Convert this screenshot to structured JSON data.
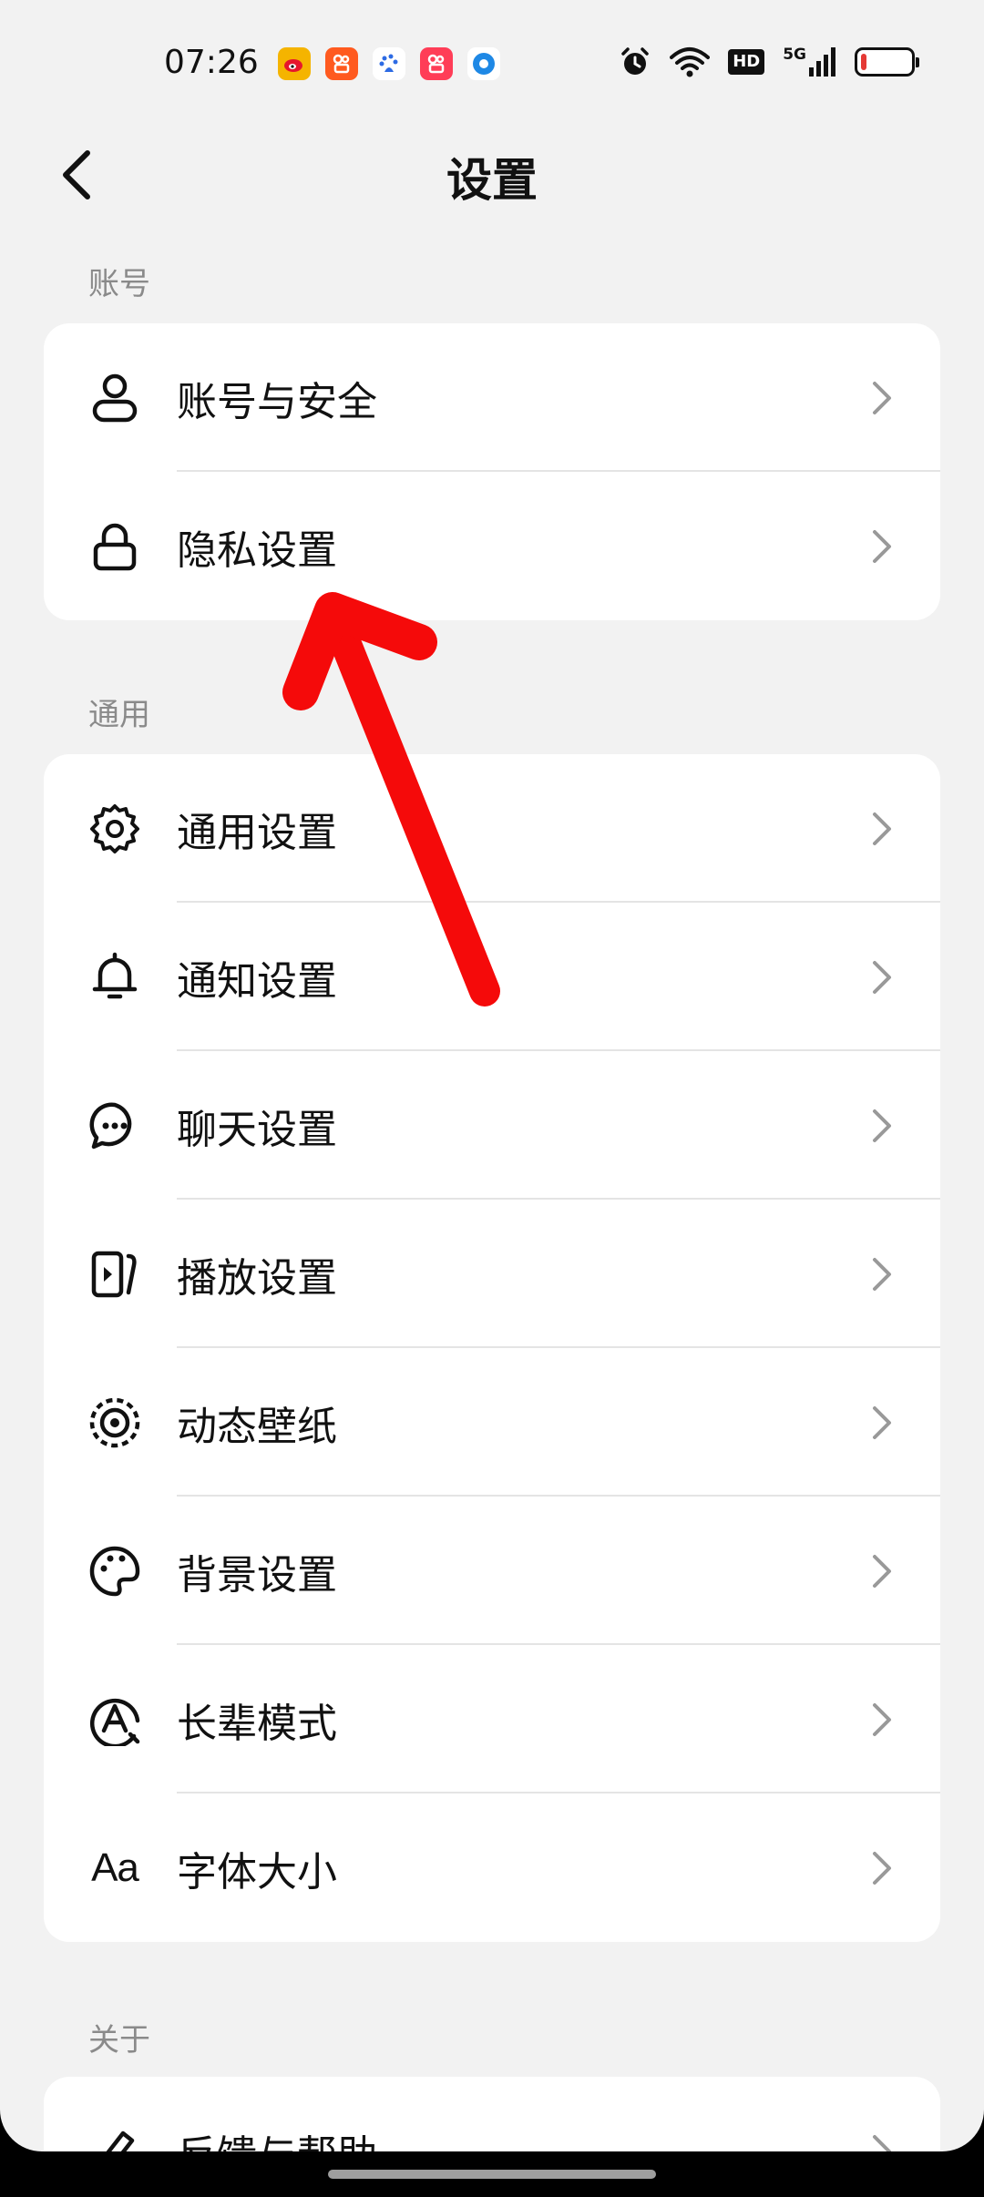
{
  "status_bar": {
    "time": "07:26",
    "notifications": [
      {
        "icon": "weibo-icon",
        "color": "#f5b400"
      },
      {
        "icon": "kuaishou-icon",
        "color": "#ff5a1f"
      },
      {
        "icon": "baidu-icon",
        "color": "#ffffff"
      },
      {
        "icon": "kuaishou-lite-icon",
        "color": "#ff3d57"
      },
      {
        "icon": "app-circle-icon",
        "color": "#ffffff"
      }
    ],
    "network_badge": "HD",
    "signal_badge": "5G"
  },
  "header": {
    "title": "设置"
  },
  "sections": {
    "account": {
      "label": "账号",
      "items": [
        {
          "label": "账号与安全",
          "icon": "user-icon"
        },
        {
          "label": "隐私设置",
          "icon": "lock-icon"
        }
      ]
    },
    "general": {
      "label": "通用",
      "items": [
        {
          "label": "通用设置",
          "icon": "gear-icon"
        },
        {
          "label": "通知设置",
          "icon": "bell-icon"
        },
        {
          "label": "聊天设置",
          "icon": "chat-icon"
        },
        {
          "label": "播放设置",
          "icon": "play-icon"
        },
        {
          "label": "动态壁纸",
          "icon": "live-wallpaper-icon"
        },
        {
          "label": "背景设置",
          "icon": "palette-icon"
        },
        {
          "label": "长辈模式",
          "icon": "elder-mode-icon"
        },
        {
          "label": "字体大小",
          "icon": "font-size-icon",
          "glyph": "Aa"
        }
      ]
    },
    "about": {
      "label": "关于",
      "items": [
        {
          "label": "反馈与帮助",
          "icon": "pencil-icon"
        }
      ]
    }
  },
  "colors": {
    "annotation_arrow": "#f50a0a",
    "background": "#f2f2f2",
    "card": "#ffffff"
  }
}
